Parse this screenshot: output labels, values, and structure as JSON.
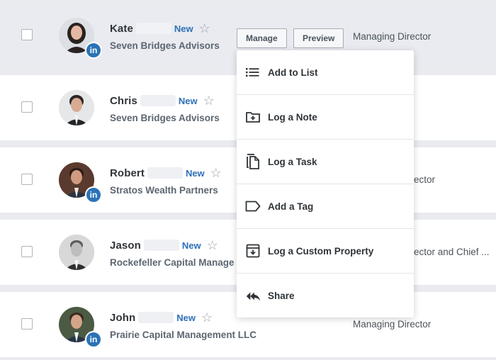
{
  "rows": [
    {
      "first_name": "Kate",
      "new_label": "New",
      "company": "Seven Bridges Advisors",
      "title": "Managing Director"
    },
    {
      "first_name": "Chris",
      "new_label": "New",
      "company": "Seven Bridges Advisors",
      "title": ""
    },
    {
      "first_name": "Robert",
      "new_label": "New",
      "company": "Stratos Wealth Partners",
      "title": "ector"
    },
    {
      "first_name": "Jason",
      "new_label": "New",
      "company": "Rockefeller Capital Manage",
      "title": "ector and Chief ..."
    },
    {
      "first_name": "John",
      "new_label": "New",
      "company": "Prairie Capital Management LLC",
      "title": "Managing Director"
    }
  ],
  "actions": {
    "manage_label": "Manage",
    "preview_label": "Preview"
  },
  "menu": {
    "items": [
      {
        "label": "Add to List",
        "icon": "list-icon"
      },
      {
        "label": "Log a Note",
        "icon": "folder-plus-icon"
      },
      {
        "label": "Log a Task",
        "icon": "copy-document-icon"
      },
      {
        "label": "Add a Tag",
        "icon": "tag-icon"
      },
      {
        "label": "Log a Custom Property",
        "icon": "archive-box-icon"
      },
      {
        "label": "Share",
        "icon": "reply-all-icon"
      }
    ]
  },
  "icons": {
    "linkedin": "in",
    "star": "☆"
  },
  "colors": {
    "new_badge": "#2e6fb7",
    "linkedin": "#2b73b6",
    "hover_row": "#e9ebf1"
  }
}
